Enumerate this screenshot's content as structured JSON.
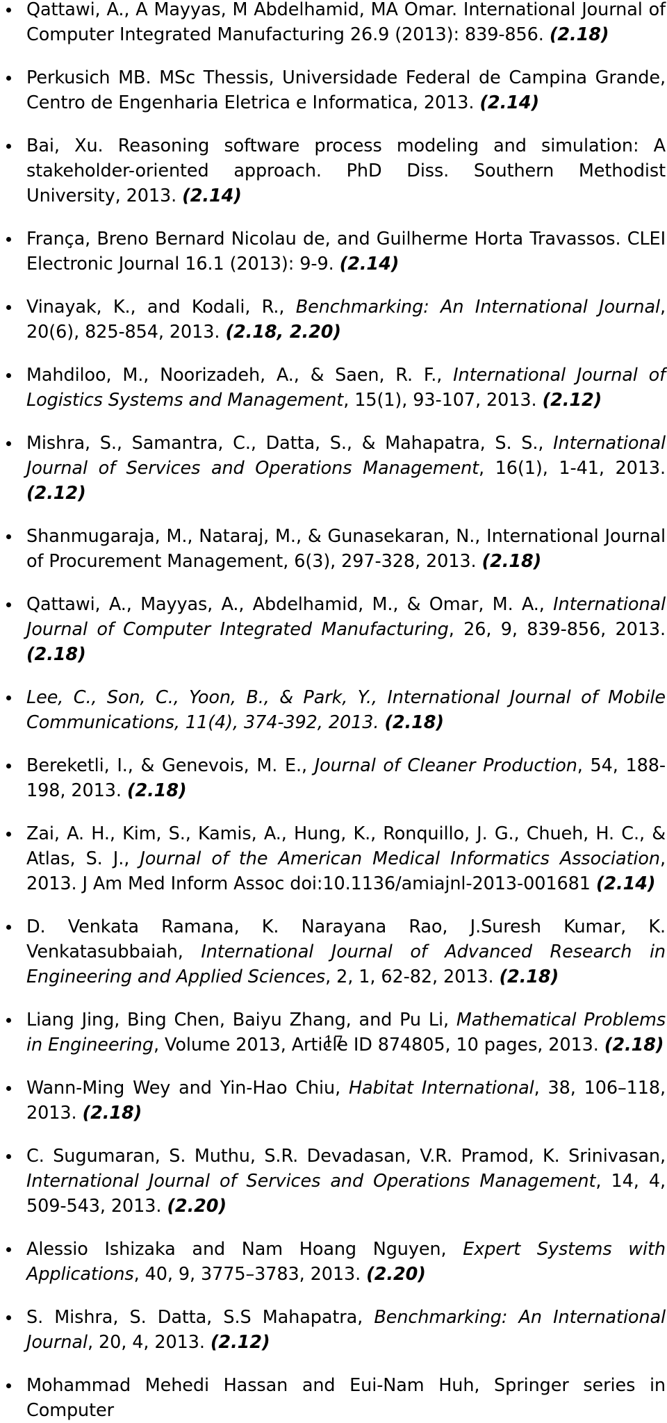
{
  "document": {
    "page_number": "17",
    "type": "bibliography-reference-list"
  },
  "references": [
    {
      "id": "ref-qattawi-2013-cim",
      "truncated_top": true,
      "segments": [
        {
          "style": "roman",
          "text": "Qattawi, A., A Mayyas, M Abdelhamid, MA Omar. International Journal of Computer Integrated Manufacturing 26.9 (2013): 839-856. "
        },
        {
          "style": "bold-italic",
          "text": "(2.18)"
        }
      ],
      "tag": "(2.18)"
    },
    {
      "id": "ref-perkusich",
      "segments": [
        {
          "style": "roman",
          "text": "Perkusich MB. MSc Thessis, Universidade Federal de Campina Grande, Centro de Engenharia Eletrica e Informatica, 2013. "
        },
        {
          "style": "bold-italic",
          "text": "(2.14)"
        }
      ],
      "tag": "(2.14)"
    },
    {
      "id": "ref-bai-xu",
      "segments": [
        {
          "style": "roman",
          "text": "Bai, Xu. Reasoning software process modeling and simulation: A stakeholder-oriented approach. PhD Diss. Southern Methodist University, 2013. "
        },
        {
          "style": "bold-italic",
          "text": "(2.14)"
        }
      ],
      "tag": "(2.14)"
    },
    {
      "id": "ref-franca",
      "segments": [
        {
          "style": "roman",
          "text": "França, Breno Bernard Nicolau de, and Guilherme Horta Travassos. CLEI Electronic Journal 16.1 (2013): 9-9. "
        },
        {
          "style": "bold-italic",
          "text": "(2.14)"
        }
      ],
      "tag": "(2.14)"
    },
    {
      "id": "ref-vinayak-kodali",
      "segments": [
        {
          "style": "roman",
          "text": "Vinayak, K., and Kodali, R., "
        },
        {
          "style": "italic",
          "text": "Benchmarking: An International Journal"
        },
        {
          "style": "roman",
          "text": ", 20(6), 825-854, 2013. "
        },
        {
          "style": "bold-italic",
          "text": "(2.18, 2.20)"
        }
      ],
      "tag": "(2.18, 2.20)"
    },
    {
      "id": "ref-mahdiloo",
      "segments": [
        {
          "style": "roman",
          "text": "Mahdiloo, M., Noorizadeh, A., & Saen, R. F., "
        },
        {
          "style": "italic",
          "text": "International Journal of Logistics Systems and Management"
        },
        {
          "style": "roman",
          "text": ", 15(1), 93-107, 2013. "
        },
        {
          "style": "bold-italic",
          "text": "(2.12)"
        }
      ],
      "tag": "(2.12)"
    },
    {
      "id": "ref-mishra-samantra",
      "segments": [
        {
          "style": "roman",
          "text": "Mishra, S., Samantra, C., Datta, S., & Mahapatra, S. S., "
        },
        {
          "style": "italic",
          "text": "International Journal of Services and Operations Management"
        },
        {
          "style": "roman",
          "text": ", 16(1), 1-41, 2013. "
        },
        {
          "style": "bold-italic",
          "text": "(2.12)"
        }
      ],
      "tag": "(2.12)"
    },
    {
      "id": "ref-shanmugaraja",
      "segments": [
        {
          "style": "roman",
          "text": "Shanmugaraja, M., Nataraj, M., & Gunasekaran, N., International Journal of Procurement Management, 6(3), 297-328, 2013. "
        },
        {
          "style": "bold-italic",
          "text": "(2.18)"
        }
      ],
      "tag": "(2.18)"
    },
    {
      "id": "ref-qattawi-mayyas",
      "segments": [
        {
          "style": "roman",
          "text": "Qattawi, A., Mayyas, A., Abdelhamid, M., & Omar, M. A., "
        },
        {
          "style": "italic",
          "text": "International Journal of Computer Integrated Manufacturing"
        },
        {
          "style": "roman",
          "text": ", 26, 9, 839-856, 2013. "
        },
        {
          "style": "bold-italic",
          "text": "(2.18)"
        }
      ],
      "tag": "(2.18)"
    },
    {
      "id": "ref-lee-son-yoon-park",
      "segments": [
        {
          "style": "italic",
          "text": "Lee, C., Son, C., Yoon, B., & Park, Y., International Journal of Mobile Communications, 11(4), 374-392, 2013. "
        },
        {
          "style": "bold-italic",
          "text": "(2.18)"
        }
      ],
      "tag": "(2.18)"
    },
    {
      "id": "ref-bereketli-genevois",
      "segments": [
        {
          "style": "roman",
          "text": "Bereketli, I., & Genevois, M. E.,  "
        },
        {
          "style": "italic",
          "text": "Journal of Cleaner Production"
        },
        {
          "style": "roman",
          "text": ", 54, 188-198, 2013. "
        },
        {
          "style": "bold-italic",
          "text": "(2.18)"
        }
      ],
      "tag": "(2.18)"
    },
    {
      "id": "ref-zai",
      "segments": [
        {
          "style": "roman",
          "text": "Zai, A. H., Kim, S., Kamis, A., Hung, K., Ronquillo, J. G., Chueh, H. C., & Atlas, S. J., "
        },
        {
          "style": "italic",
          "text": "Journal of the American Medical Informatics Association"
        },
        {
          "style": "roman",
          "text": ", 2013. J Am Med Inform Assoc doi:10.1136/amiajnl-2013-001681 "
        },
        {
          "style": "bold-italic",
          "text": "(2.14)"
        }
      ],
      "tag": "(2.14)"
    },
    {
      "id": "ref-venkata-ramana",
      "segments": [
        {
          "style": "roman",
          "text": "D. Venkata Ramana, K. Narayana Rao, J.Suresh Kumar, K. Venkatasubbaiah, "
        },
        {
          "style": "italic",
          "text": "International Journal of Advanced Research in Engineering and Applied Sciences"
        },
        {
          "style": "roman",
          "text": ", 2, 1, 62-82, 2013. "
        },
        {
          "style": "bold-italic",
          "text": "(2.18)"
        }
      ],
      "tag": "(2.18)"
    },
    {
      "id": "ref-liang-jing",
      "segments": [
        {
          "style": "roman",
          "text": "Liang Jing, Bing Chen, Baiyu Zhang, and Pu Li, "
        },
        {
          "style": "italic",
          "text": "Mathematical Problems in Engineering"
        },
        {
          "style": "roman",
          "text": ", Volume 2013, Article ID 874805, 10 pages, 2013. "
        },
        {
          "style": "bold-italic",
          "text": "(2.18)"
        }
      ],
      "tag": "(2.18)"
    },
    {
      "id": "ref-wann-ming-wey",
      "segments": [
        {
          "style": "roman",
          "text": "Wann-Ming Wey and Yin-Hao Chiu, "
        },
        {
          "style": "italic",
          "text": "Habitat International"
        },
        {
          "style": "roman",
          "text": ", 38, 106–118, 2013. "
        },
        {
          "style": "bold-italic",
          "text": "(2.18)"
        }
      ],
      "tag": "(2.18)"
    },
    {
      "id": "ref-sugumaran",
      "segments": [
        {
          "style": "roman",
          "text": "C. Sugumaran, S. Muthu, S.R. Devadasan, V.R. Pramod, K. Srinivasan, "
        },
        {
          "style": "italic",
          "text": "International Journal of Services and Operations Management"
        },
        {
          "style": "roman",
          "text": ", 14, 4, 509-543, 2013. "
        },
        {
          "style": "bold-italic",
          "text": "(2.20)"
        }
      ],
      "tag": "(2.20)"
    },
    {
      "id": "ref-ishizaka-nguyen",
      "segments": [
        {
          "style": "roman",
          "text": "Alessio Ishizaka and Nam Hoang Nguyen, "
        },
        {
          "style": "italic",
          "text": "Expert Systems with Applications"
        },
        {
          "style": "roman",
          "text": ", 40, 9, 3775–3783, 2013. "
        },
        {
          "style": "bold-italic",
          "text": "(2.20)"
        }
      ],
      "tag": "(2.20)"
    },
    {
      "id": "ref-s-mishra-datta",
      "segments": [
        {
          "style": "roman",
          "text": "S. Mishra, S. Datta, S.S Mahapatra, "
        },
        {
          "style": "italic",
          "text": "Benchmarking: An International Journal"
        },
        {
          "style": "roman",
          "text": ", 20, 4, 2013. "
        },
        {
          "style": "bold-italic",
          "text": "(2.12)"
        }
      ],
      "tag": "(2.12)"
    },
    {
      "id": "ref-mohammad-mehedi-hassan",
      "truncated_bottom": true,
      "segments": [
        {
          "style": "roman",
          "text": "Mohammad Mehedi Hassan and Eui-Nam Huh, Springer series in Computer"
        }
      ],
      "tag": ""
    }
  ]
}
